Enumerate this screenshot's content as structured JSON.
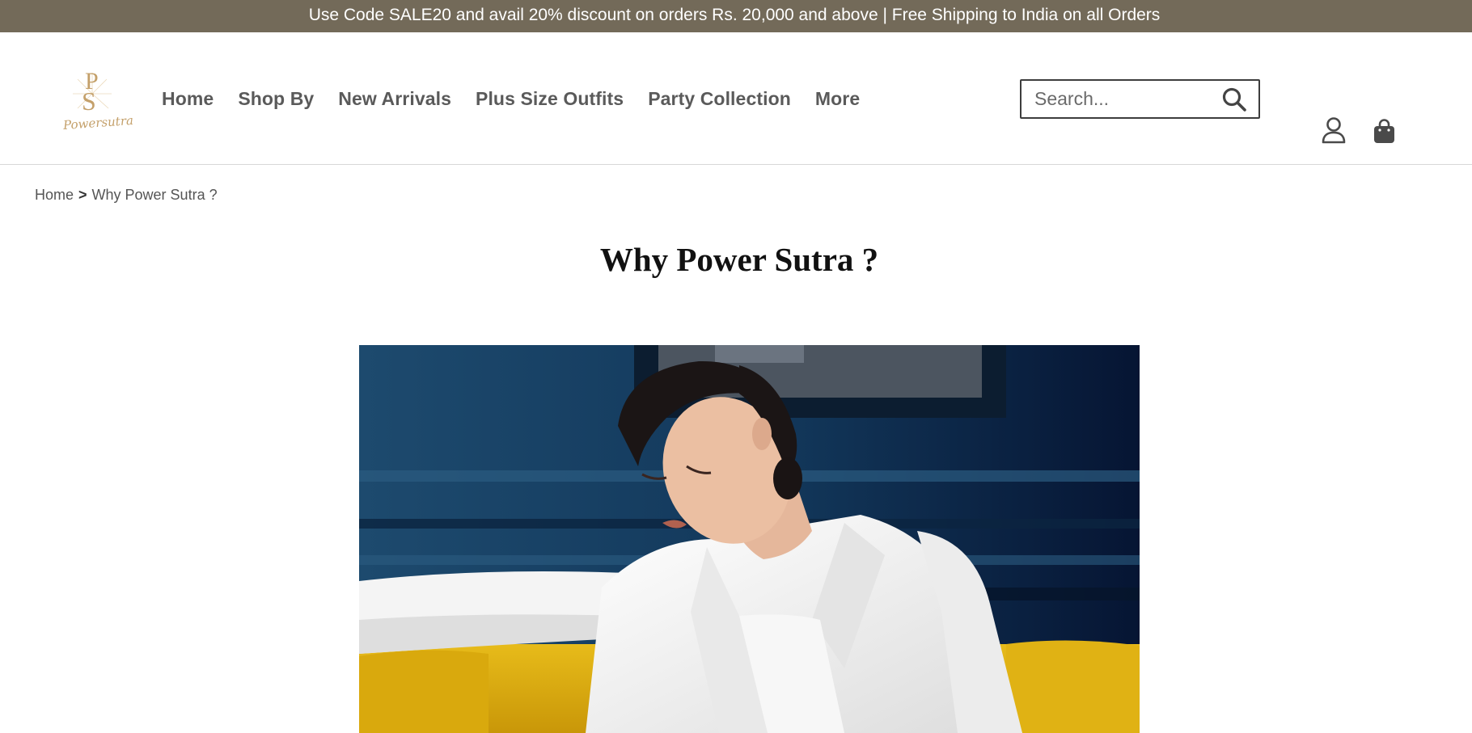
{
  "announcement": {
    "text": "Use Code SALE20 and avail 20% discount on orders Rs. 20,000 and above | Free Shipping to India on all Orders"
  },
  "brand": {
    "logo_monogram": "PS",
    "logo_script": "Powersutra",
    "accent_color": "#c4a06a"
  },
  "nav": {
    "items": [
      {
        "label": "Home"
      },
      {
        "label": "Shop By"
      },
      {
        "label": "New Arrivals"
      },
      {
        "label": "Plus Size Outfits"
      },
      {
        "label": "Party Collection"
      },
      {
        "label": "More"
      }
    ]
  },
  "search": {
    "placeholder": "Search...",
    "value": "",
    "icon": "search-icon"
  },
  "header_icons": {
    "account": "user-icon",
    "cart": "shopping-bag-icon"
  },
  "breadcrumb": {
    "home": "Home",
    "separator": ">",
    "current": "Why Power Sutra ?"
  },
  "page": {
    "title": "Why Power Sutra ?"
  },
  "colors": {
    "announcement_bg": "#736a59",
    "nav_text": "#5a5a5a"
  }
}
